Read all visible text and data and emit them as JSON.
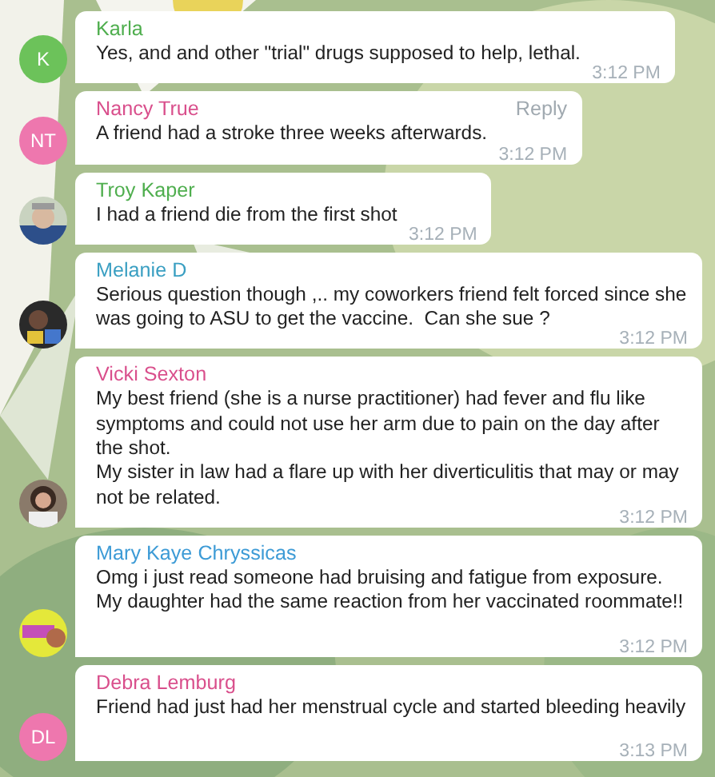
{
  "messages": [
    {
      "sender": "Karla",
      "color": "#4fae4e",
      "avatar": {
        "kind": "initials",
        "initials": "K",
        "color": "#6cc25a"
      },
      "text": "Yes, and and other \"trial\" drugs supposed to help, lethal.",
      "time": "3:12 PM"
    },
    {
      "sender": "Nancy True",
      "color": "#d94f8c",
      "avatar": {
        "kind": "initials",
        "initials": "NT",
        "color": "#ee77ae"
      },
      "action": "Reply",
      "text": "A friend had a stroke three weeks afterwards.",
      "time": "3:12 PM"
    },
    {
      "sender": "Troy Kaper",
      "color": "#4fae4e",
      "text": "I had a friend die from the first shot",
      "time": "3:12 PM"
    },
    {
      "sender": "Melanie D",
      "color": "#3a9fc2",
      "text": "Serious question though ,.. my coworkers friend felt forced since she was going to ASU to get the vaccine.  Can she sue ?",
      "time": "3:12 PM"
    },
    {
      "sender": "Vicki Sexton",
      "color": "#d94f8c",
      "text": "My best friend (she is a nurse practitioner) had fever and flu like symptoms and could not use her arm due to pain on the day after the shot.\nMy sister in law had a flare up with her diverticulitis that may or may not be related.",
      "time": "3:12 PM"
    },
    {
      "sender": "Mary Kaye Chryssicas",
      "color": "#3d9bd6",
      "text": "Omg i just read someone had bruising and fatigue from exposure. My daughter had the same reaction from her vaccinated roommate!!",
      "time": "3:12 PM"
    },
    {
      "sender": "Debra Lemburg",
      "color": "#d94f8c",
      "avatar": {
        "kind": "initials",
        "initials": "DL",
        "color": "#ee77ae"
      },
      "text": "Friend had just had her menstrual cycle and started bleeding heavily",
      "time": "3:13 PM"
    }
  ]
}
